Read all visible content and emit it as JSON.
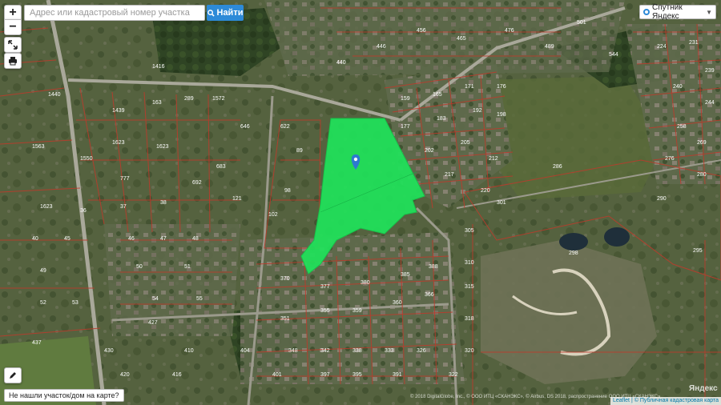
{
  "toolbar": {
    "zoom_in": "+",
    "zoom_out": "−",
    "search_placeholder": "Адрес или кадастровый номер участка",
    "search_value": "",
    "find_label": "Найти"
  },
  "layers": {
    "selected": "Спутник Яндекс"
  },
  "footer": {
    "not_found": "Не нашли участок/дом на карте?",
    "copyright": "© 2018 DigitalGlobe, Inc., © ООО ИТЦ «СКАНЭКС», © Airbus, DS 2018, распространение ООО ИТЦ «СКАНЭКС»",
    "yandex": "Яндекс",
    "attribution_leaflet": "Leaflet",
    "attribution_sep": " | ",
    "attribution_source": "© Публичная кадастровая карта"
  },
  "parcel_labels": [
    "1416",
    "1440",
    "1439",
    "163",
    "289",
    "1572",
    "1563",
    "1550",
    "1623",
    "1623",
    "1623",
    "36",
    "37",
    "38",
    "40",
    "45",
    "46",
    "47",
    "48",
    "49",
    "50",
    "51",
    "52",
    "53",
    "54",
    "55",
    "89",
    "98",
    "102",
    "121",
    "159",
    "165",
    "171",
    "176",
    "177",
    "183",
    "192",
    "198",
    "202",
    "205",
    "212",
    "217",
    "220",
    "224",
    "231",
    "239",
    "240",
    "244",
    "258",
    "269",
    "276",
    "280",
    "286",
    "290",
    "295",
    "298",
    "301",
    "305",
    "310",
    "315",
    "318",
    "320",
    "322",
    "326",
    "333",
    "338",
    "342",
    "348",
    "351",
    "355",
    "359",
    "360",
    "366",
    "370",
    "377",
    "380",
    "385",
    "388",
    "391",
    "395",
    "397",
    "401",
    "404",
    "410",
    "416",
    "420",
    "427",
    "430",
    "437",
    "440",
    "446",
    "456",
    "465",
    "476",
    "489",
    "501",
    "544",
    "622",
    "646",
    "683",
    "692",
    "777"
  ],
  "colors": {
    "selected_parcel": "#1fe35a",
    "parcel_border": "#c0392b",
    "marker": "#2d7ad0",
    "map_base": "#4d5a3e"
  },
  "icons": {
    "marker": "location-pin-icon",
    "fullscreen": "expand-icon",
    "print": "print-icon",
    "edit": "pencil-icon",
    "find": "search-icon"
  }
}
